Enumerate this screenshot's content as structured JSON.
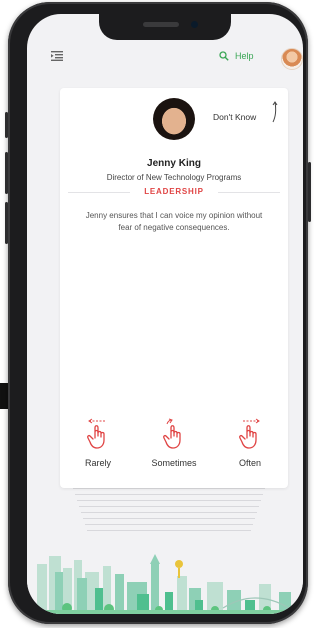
{
  "header": {
    "menu_icon": "list-menu-icon",
    "search_icon": "search-icon",
    "help_label": "Help",
    "accent_color": "#3aa655"
  },
  "card": {
    "skip_label": "Don't Know",
    "person": {
      "name": "Jenny King",
      "title": "Director of New Technology Programs"
    },
    "category": "LEADERSHIP",
    "category_color": "#e04545",
    "statement": "Jenny ensures that I can voice my opinion without fear of negative consequences.",
    "options": [
      {
        "label": "Rarely",
        "icon": "swipe-left-hand-icon"
      },
      {
        "label": "Sometimes",
        "icon": "tap-hand-icon"
      },
      {
        "label": "Often",
        "icon": "swipe-right-hand-icon"
      }
    ]
  }
}
